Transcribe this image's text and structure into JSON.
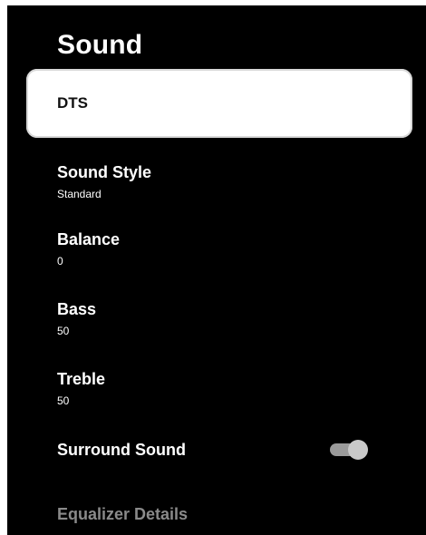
{
  "screen": {
    "title": "Sound"
  },
  "menu": {
    "selected_item": "DTS",
    "items": [
      {
        "label": "Sound Style",
        "value": "Standard"
      },
      {
        "label": "Balance",
        "value": "0"
      },
      {
        "label": "Bass",
        "value": "50"
      },
      {
        "label": "Treble",
        "value": "50"
      }
    ],
    "surround_sound": {
      "label": "Surround Sound",
      "enabled": true
    },
    "equalizer_details": {
      "label": "Equalizer Details"
    }
  },
  "colors": {
    "background": "#000000",
    "text": "#ffffff",
    "selected_background": "#ffffff",
    "disabled_text": "#8a8a8a",
    "toggle_knob": "#c9c9c9",
    "toggle_track": "#9a9a9a"
  }
}
